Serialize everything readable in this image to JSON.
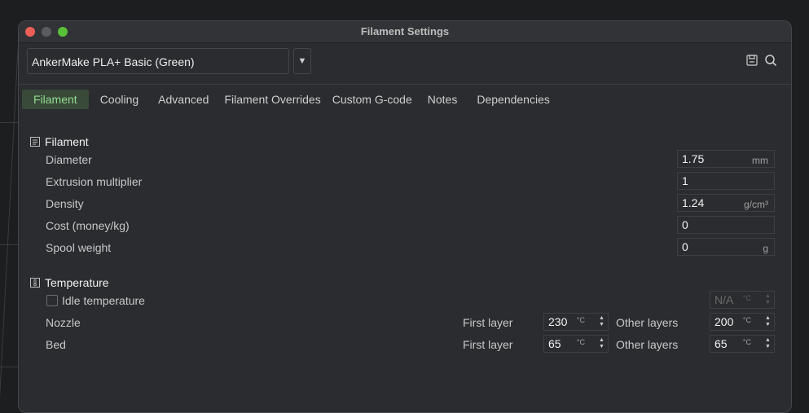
{
  "window": {
    "title": "Filament Settings"
  },
  "preset": {
    "name": "AnkerMake PLA+ Basic (Green)",
    "dropdown_glyph": "▼"
  },
  "toolbar": {
    "icons": [
      "save-icon",
      "search-icon"
    ]
  },
  "tabs": [
    {
      "label": "Filament",
      "active": true
    },
    {
      "label": "Cooling",
      "active": false
    },
    {
      "label": "Advanced",
      "active": false
    },
    {
      "label": "Filament Overrides",
      "active": false
    },
    {
      "label": "Custom G-code",
      "active": false
    },
    {
      "label": "Notes",
      "active": false
    },
    {
      "label": "Dependencies",
      "active": false
    }
  ],
  "filament_section": {
    "title": "Filament",
    "rows": [
      {
        "label": "Diameter",
        "value": "1.75",
        "unit": "mm"
      },
      {
        "label": "Extrusion multiplier",
        "value": "1",
        "unit": ""
      },
      {
        "label": "Density",
        "value": "1.24",
        "unit": "g/cm³"
      },
      {
        "label": "Cost (money/kg)",
        "value": "0",
        "unit": ""
      },
      {
        "label": "Spool weight",
        "value": "0",
        "unit": "g"
      }
    ]
  },
  "temperature_section": {
    "title": "Temperature",
    "idle": {
      "label": "Idle temperature",
      "checked": false,
      "value": "N/A",
      "unit": "°C"
    },
    "nozzle": {
      "label": "Nozzle",
      "first_layer_label": "First layer",
      "first_layer_value": "230",
      "first_layer_unit": "°C",
      "other_layers_label": "Other layers",
      "other_layers_value": "200",
      "other_layers_unit": "°C"
    },
    "bed": {
      "label": "Bed",
      "first_layer_label": "First layer",
      "first_layer_value": "65",
      "first_layer_unit": "°C",
      "other_layers_label": "Other layers",
      "other_layers_value": "65",
      "other_layers_unit": "°C"
    }
  },
  "colors": {
    "accent": "#8fdc8f",
    "tab_active_bg": "#3a4a3a",
    "window_bg": "#2b2c2f"
  }
}
